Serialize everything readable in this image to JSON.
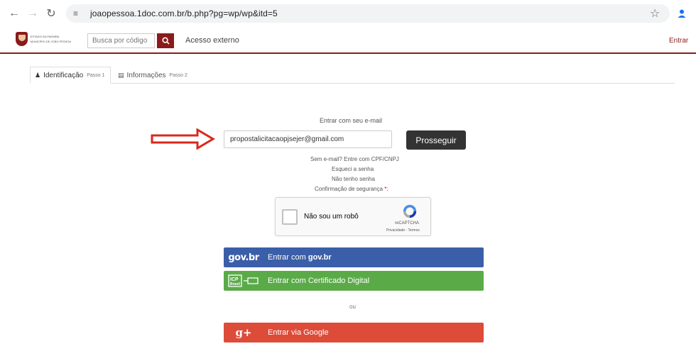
{
  "browser": {
    "url": "joaopessoa.1doc.com.br/b.php?pg=wp/wp&itd=5"
  },
  "header": {
    "logo_line1": "ESTADO DA PARAÍBA",
    "logo_line2": "MUNICÍPIO DE JOÃO PESSOA",
    "search_placeholder": "Busca por código",
    "acesso_externo": "Acesso externo",
    "entrar": "Entrar"
  },
  "tabs": [
    {
      "label": "Identificação",
      "step": "Passo 1",
      "active": true
    },
    {
      "label": "Informações",
      "step": "Passo 2",
      "active": false
    }
  ],
  "form": {
    "email_label": "Entrar com seu e-mail",
    "email_value": "propostalicitacaopjsejer@gmail.com",
    "proceed_label": "Prosseguir",
    "no_email": "Sem e-mail? Entre com CPF/CNPJ",
    "forgot_password": "Esqueci a senha",
    "no_password": "Não tenho senha",
    "security_confirmation": "Confirmação de segurança",
    "required_mark": "*:"
  },
  "recaptcha": {
    "label": "Não sou um robô",
    "brand": "reCAPTCHA",
    "terms": "Privacidade - Termos"
  },
  "auth": {
    "govbr_logo": "gov.br",
    "govbr_prefix": "Entrar com",
    "govbr_brand": "gov.br",
    "cert_label": "Entrar com Certificado Digital",
    "cert_logo": "ICP Brasil",
    "or_label": "ou",
    "google_label": "Entrar via Google",
    "google_logo": "g+"
  },
  "colors": {
    "brand": "#8b1a1a",
    "govbr": "#3b5ea8",
    "cert": "#5aab48",
    "google": "#dd4b39",
    "arrow": "#d9281c"
  }
}
